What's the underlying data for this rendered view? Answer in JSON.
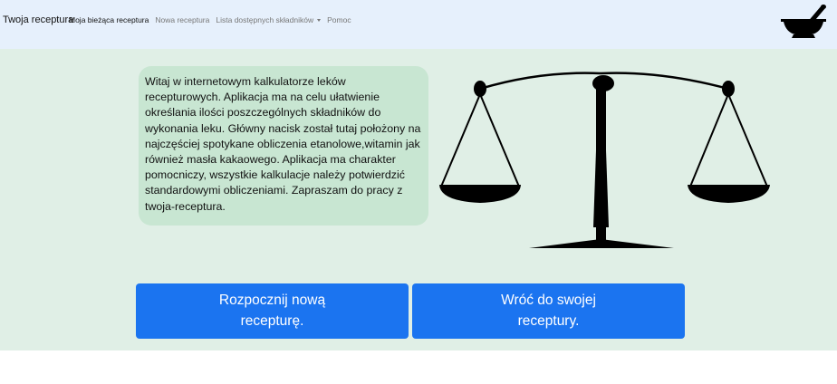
{
  "navbar": {
    "brand": "Twoja receptura",
    "items": [
      {
        "label": "Moja bieżąca receptura",
        "active": true,
        "dropdown": false
      },
      {
        "label": "Nowa receptura",
        "active": false,
        "dropdown": false
      },
      {
        "label": "Lista dostępnych składników",
        "active": false,
        "dropdown": true
      },
      {
        "label": "Pomoc",
        "active": false,
        "dropdown": false
      }
    ],
    "logo_icon": "mortar-and-pestle-icon"
  },
  "main": {
    "welcome_text": "Witaj w internetowym kalkulatorze leków recepturowych. Aplikacja ma na celu ułatwienie określania ilości poszczególnych składników do wykonania leku. Główny nacisk został tutaj położony na najczęściej spotykane obliczenia etanolowe,witamin jak również masła kakaowego. Aplikacja ma charakter pomocniczy, wszystkie kalkulacje należy potwierdzić standardowymi obliczeniami. Zapraszam do pracy z twoja-receptura.",
    "illustration_icon": "balance-scale-icon",
    "start_button": {
      "line1": "Rozpocznij nową",
      "line2": "recepturę."
    },
    "back_button": {
      "line1": "Wróć do swojej",
      "line2": "receptury."
    }
  },
  "colors": {
    "navbar_bg": "#e6f0fc",
    "main_bg": "#e0efe6",
    "panel_bg": "#c8e6d2",
    "button_bg": "#1b74f0"
  }
}
